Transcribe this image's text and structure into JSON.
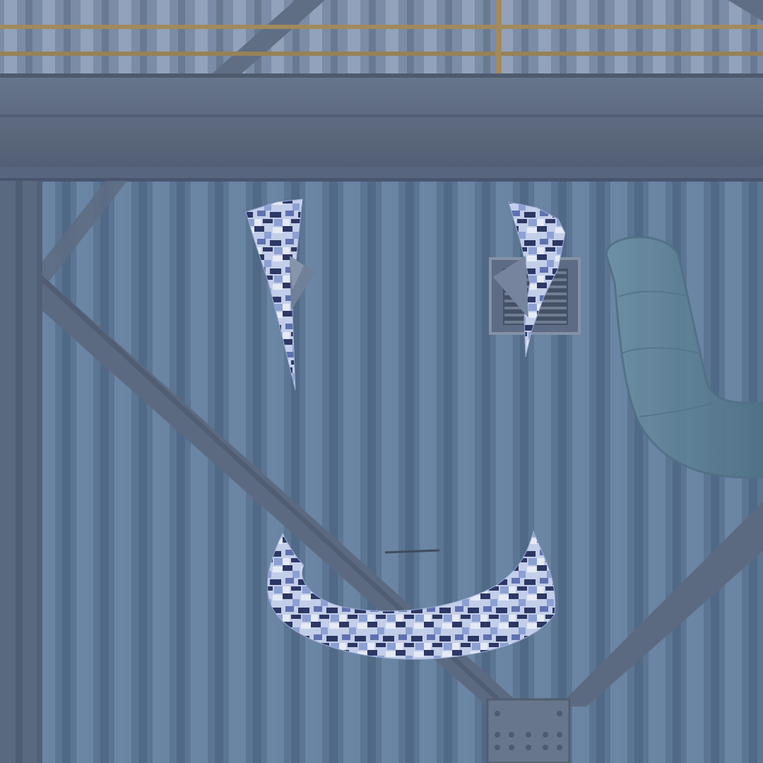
{
  "scene": {
    "description_visible_text": [],
    "palette": {
      "wall_light": "#6f89a6",
      "wall_mid": "#5a7592",
      "wall_dark": "#47607c",
      "beam": "#5d6b7e",
      "beam_dark": "#4a5668",
      "railing": "#a48a55",
      "pipe": "#5f8195",
      "camo_light": "#dfe6f5",
      "camo_mid": "#8ea2d6",
      "camo_dark": "#27305e",
      "vent": "#67758a"
    },
    "objects": [
      {
        "name": "upper-walkway",
        "icon": "walkway"
      },
      {
        "name": "safety-railing",
        "icon": "railing"
      },
      {
        "name": "horizontal-steel-beam",
        "icon": "beam"
      },
      {
        "name": "diagonal-cross-braces",
        "icon": "x-brace"
      },
      {
        "name": "wall-vent-grille",
        "icon": "vent-icon"
      },
      {
        "name": "curved-duct-pipe",
        "icon": "pipe"
      },
      {
        "name": "camo-face-left-eye",
        "icon": "camo-shard"
      },
      {
        "name": "camo-face-right-eye",
        "icon": "camo-shard"
      },
      {
        "name": "camo-face-smile",
        "icon": "camo-arc"
      },
      {
        "name": "bolted-base-plate",
        "icon": "plate"
      }
    ]
  }
}
